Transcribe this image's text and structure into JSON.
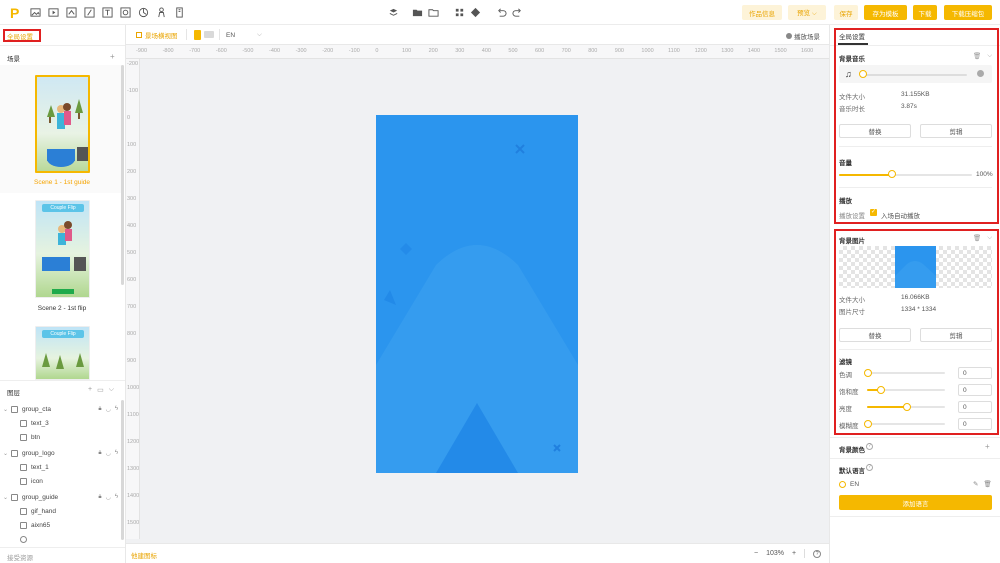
{
  "toolbar": {
    "logo": "P",
    "icons": [
      "image-icon",
      "play-icon",
      "layers-icon",
      "gesture-icon",
      "text-icon",
      "gallery-icon",
      "transform-icon",
      "touch-icon",
      "device-icon"
    ],
    "center_icons": [
      "stack-icon",
      "folder-icon",
      "folder-icon",
      "grid-icon",
      "component-icon",
      "undo-icon",
      "redo-icon"
    ],
    "buttons": {
      "info": "作品信息",
      "preview": "预览 ⌵",
      "save": "保存",
      "save_template": "存为模板",
      "download": "下载",
      "download_zip": "下载压缩包"
    }
  },
  "left": {
    "global_settings": "全局设置",
    "scenes_title": "场景",
    "scenes": [
      {
        "label": "Scene 1 - 1st guide",
        "active": true
      },
      {
        "label": "Scene 2 - 1st flip",
        "active": false
      }
    ],
    "thumb_text": "Couple Flip",
    "layers_title": "图层",
    "layers": [
      {
        "name": "group_cta",
        "type": "group"
      },
      {
        "name": "text_3",
        "type": "text"
      },
      {
        "name": "btn",
        "type": "image"
      },
      {
        "name": "group_logo",
        "type": "group"
      },
      {
        "name": "text_1",
        "type": "text"
      },
      {
        "name": "icon",
        "type": "image"
      },
      {
        "name": "group_guide",
        "type": "group"
      },
      {
        "name": "gif_hand",
        "type": "image"
      },
      {
        "name": "aixn65",
        "type": "spine"
      }
    ],
    "bottom_label": "接受资源"
  },
  "canvas": {
    "landscape_view": "景场横视图",
    "lang": "EN",
    "play_scene": "播放场景",
    "ruler_h": [
      "-900",
      "-800",
      "-700",
      "-600",
      "-500",
      "-400",
      "-300",
      "-200",
      "-100",
      "0",
      "100",
      "200",
      "300",
      "400",
      "500",
      "600",
      "700",
      "800",
      "900",
      "1000",
      "1100",
      "1200",
      "1300",
      "1400",
      "1500",
      "1600"
    ],
    "ruler_v": [
      "-200",
      "-100",
      "0",
      "100",
      "200",
      "300",
      "400",
      "500",
      "600",
      "700",
      "800",
      "900",
      "1000",
      "1100",
      "1200",
      "1300",
      "1400",
      "1500"
    ],
    "bottom_left": "他建图标",
    "zoom": "103%"
  },
  "right": {
    "tab_global": "全局设置",
    "bg_music": {
      "title": "背景音乐",
      "file_size_label": "文件大小",
      "file_size": "31.155KB",
      "duration_label": "音乐时长",
      "duration": "3.87s",
      "replace": "替换",
      "crop": "剪辑"
    },
    "volume": {
      "title": "音量",
      "value": "100%",
      "level": 0.4
    },
    "playback": {
      "title": "播放",
      "setting_label": "播放设置",
      "autoplay_label": "入场自动播放",
      "autoplay": true
    },
    "bg_image": {
      "title": "背景图片",
      "file_size_label": "文件大小",
      "file_size": "16.066KB",
      "dims_label": "图片尺寸",
      "dims": "1334 * 1334",
      "replace": "替换",
      "crop": "剪辑"
    },
    "filters": {
      "title": "滤镜",
      "items": [
        {
          "label": "色调",
          "value": "0",
          "level": 0.0
        },
        {
          "label": "饱和度",
          "value": "0",
          "level": 0.17
        },
        {
          "label": "亮度",
          "value": "0",
          "level": 0.5
        },
        {
          "label": "模糊度",
          "value": "0",
          "level": 0.0
        }
      ]
    },
    "bg_color": {
      "title": "背景颜色"
    },
    "default_lang": {
      "title": "默认语言",
      "lang": "EN",
      "add_button": "添加语言"
    }
  },
  "colors": {
    "accent": "#f5b800",
    "canvas_blue": "#2b95ee",
    "highlight": "#e02020"
  }
}
